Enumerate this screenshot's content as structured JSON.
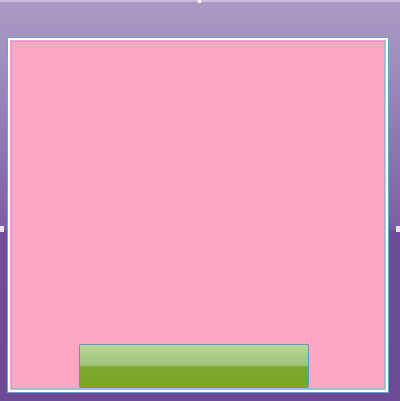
{
  "window": {
    "title": ""
  },
  "panel": {
    "background_color": "#ffa8c4",
    "frame_color": "#a99ac4"
  },
  "action_button": {
    "label": "",
    "color": "#8ab43a"
  }
}
